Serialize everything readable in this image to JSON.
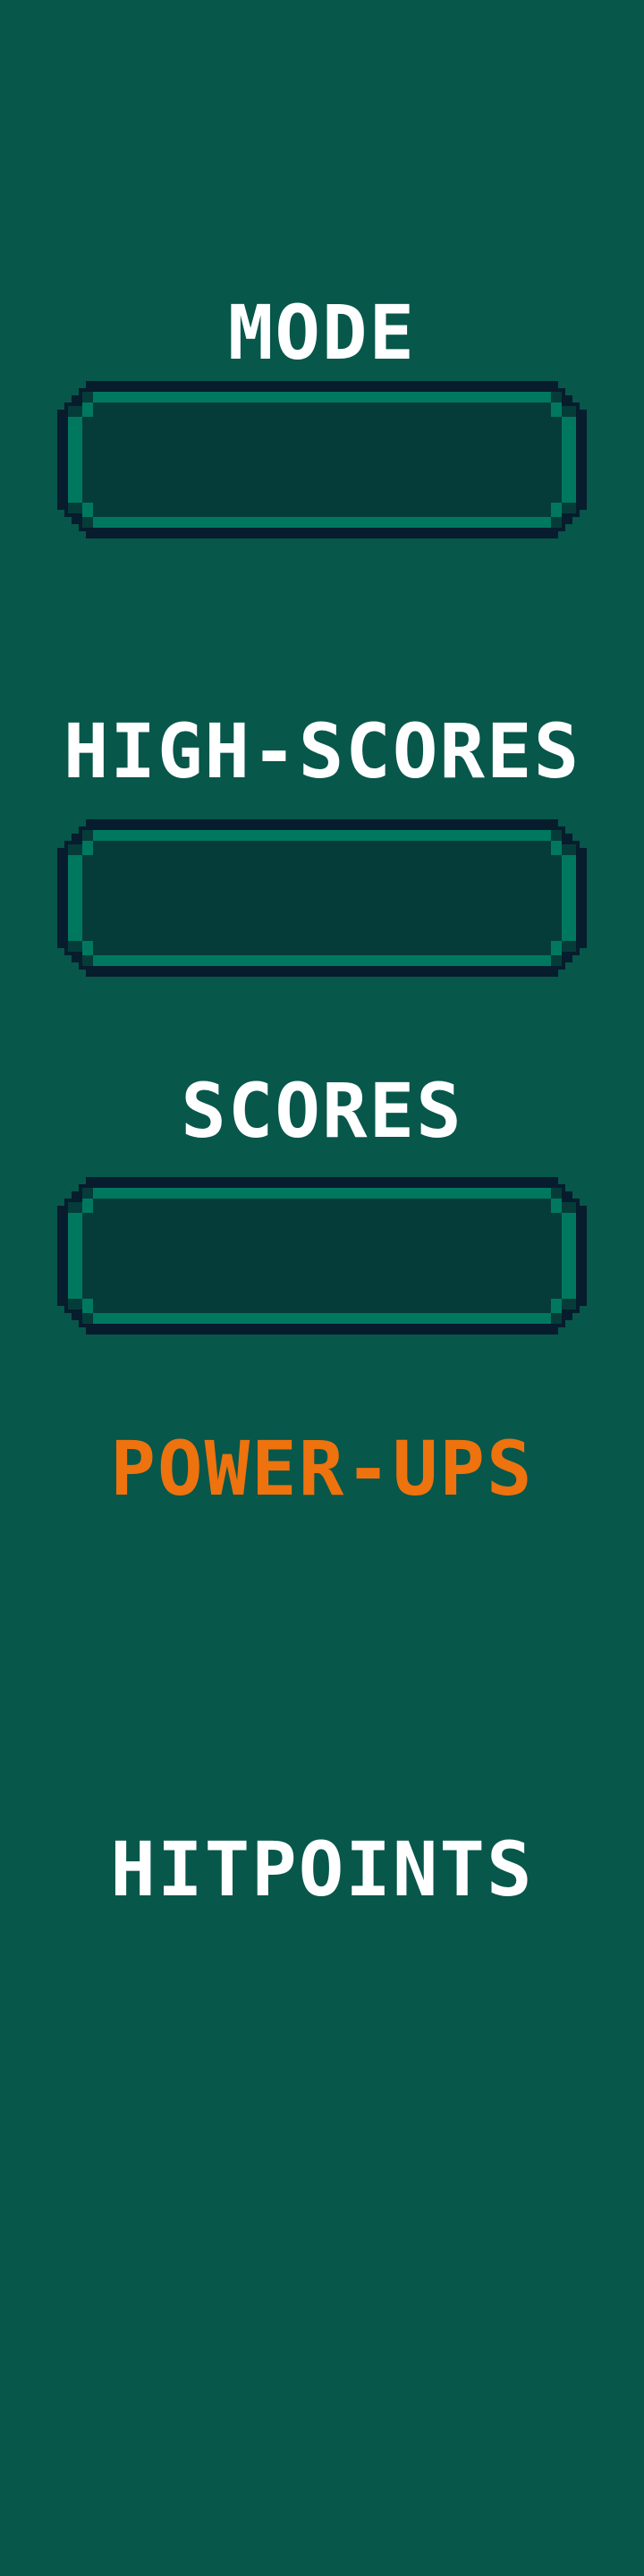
{
  "colors": {
    "background": "#07574b",
    "panel_fill": "#053c39",
    "panel_border": "#071c2c",
    "panel_inner_line": "#00785f",
    "label_text": "#ffffff",
    "accent_text": "#ee720e"
  },
  "labels": {
    "mode": "MODE",
    "high_scores": "HIGH-SCORES",
    "scores": "SCORES",
    "power_ups": "POWER-UPS",
    "hitpoints": "HITPOINTS"
  },
  "panels": {
    "mode_value": "",
    "high_scores_value": "",
    "scores_value": ""
  }
}
